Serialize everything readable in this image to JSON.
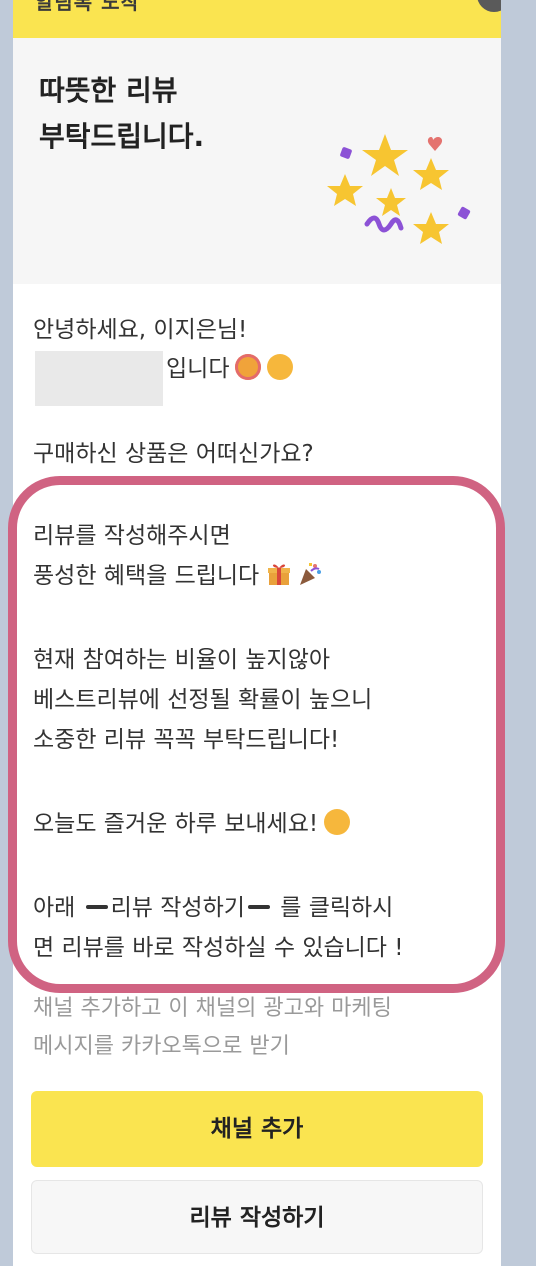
{
  "notice": {
    "label": "알림톡 도착"
  },
  "hero": {
    "title_line1": "따뜻한 리뷰",
    "title_line2": "부탁드립니다."
  },
  "message": {
    "greeting": "안녕하세요, 이지은님!",
    "sender_suffix": "입니다",
    "question": "구매하신 상품은 어떠신가요?",
    "benefit_line1": "리뷰를 작성해주시면",
    "benefit_line2": "풍성한 혜택을 드립니다",
    "rate_line1": "현재 참여하는 비율이 높지않아",
    "rate_line2": "베스트리뷰에 선정될 확률이 높으니",
    "rate_line3": "소중한 리뷰 꼭꼭 부탁드립니다!",
    "wish": "오늘도 즐거운 하루 보내세요!",
    "cta_prefix": "아래",
    "cta_link": "리뷰 작성하기",
    "cta_suffix": "를 클릭하시",
    "cta_line2": "면 리뷰를 바로 작성하실 수 있습니다 !"
  },
  "channel_note": {
    "line1": "채널 추가하고 이 채널의 광고와 마케팅",
    "line2": "메시지를 카카오톡으로 받기"
  },
  "buttons": {
    "add_channel": "채널 추가",
    "write_review": "리뷰 작성하기"
  },
  "colors": {
    "kakao_yellow": "#fae450",
    "highlight_border": "#d06382",
    "background": "#bfcad9"
  },
  "icons": [
    "stars-confetti-icon",
    "smiling-hearts-emoji-icon",
    "yum-emoji-icon",
    "gift-icon",
    "party-popper-icon"
  ]
}
